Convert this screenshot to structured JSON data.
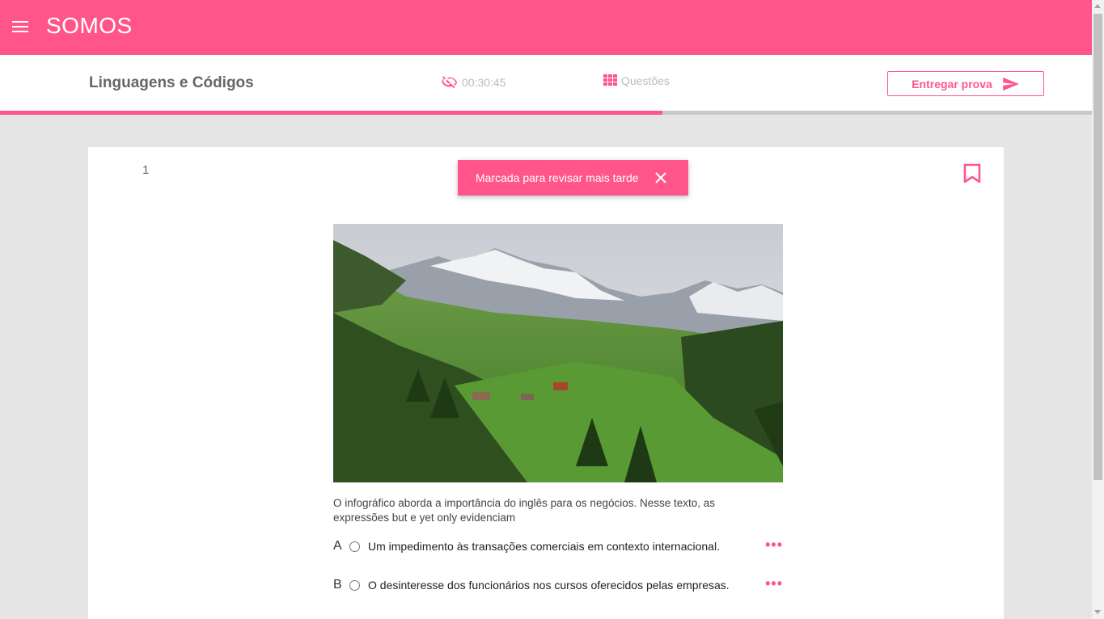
{
  "app": {
    "brand": "SOMOS"
  },
  "header": {
    "subject": "Linguagens e Códigos",
    "timer": "00:30:45",
    "questions_label": "Questões",
    "deliver_label": "Entregar prova"
  },
  "progress": {
    "fraction": 0.607
  },
  "colors": {
    "accent": "#ff558b"
  },
  "question": {
    "number": "1",
    "toast": "Marcada para revisar mais tarde",
    "stem": "O infográfico aborda a importância do inglês para os negócios. Nesse texto, as expressões but e yet only evidenciam",
    "options": [
      {
        "letter": "A",
        "text": "Um impedimento às transações comerciais em contexto internacional."
      },
      {
        "letter": "B",
        "text": "O desinteresse dos funcionários nos cursos oferecidos pelas empresas."
      }
    ],
    "more_label": "•••"
  },
  "icons": {
    "menu": "menu-icon",
    "timer": "eye-off-icon",
    "questions": "grid-icon",
    "deliver": "send-icon",
    "bookmark": "bookmark-icon",
    "close": "close-icon"
  }
}
